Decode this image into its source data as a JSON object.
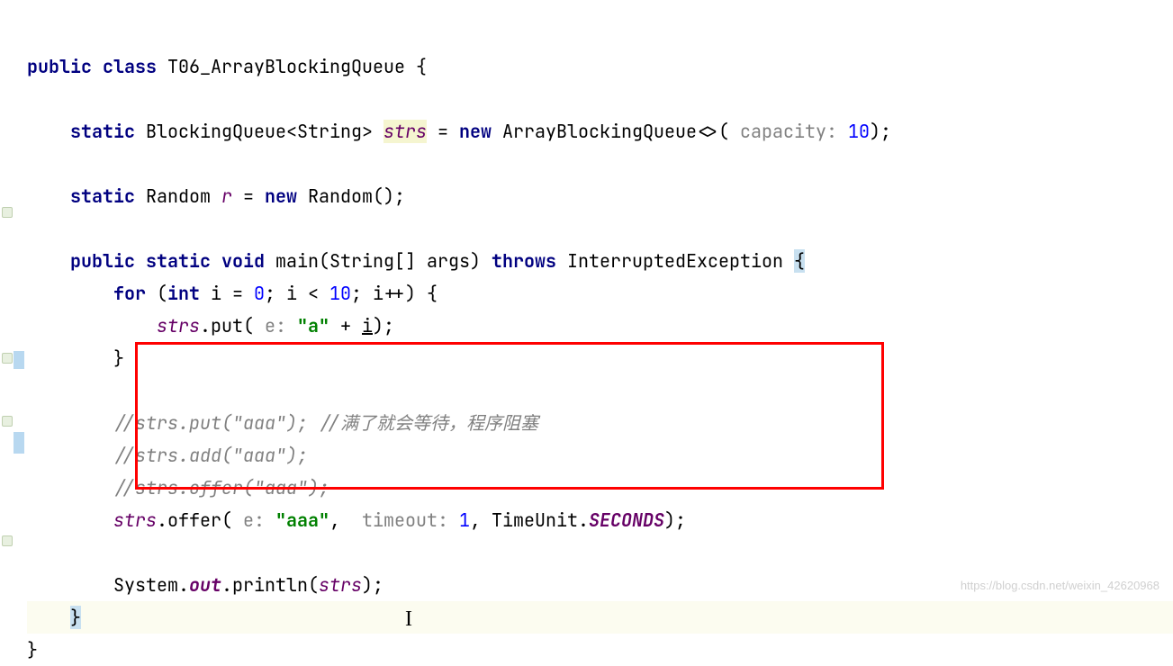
{
  "code": {
    "line1": {
      "kw_public": "public",
      "kw_class": "class",
      "class_name": "T06_ArrayBlockingQueue",
      "brace": "{"
    },
    "line3": {
      "kw_static": "static",
      "type": "BlockingQueue<String>",
      "field": "strs",
      "eq": "=",
      "kw_new": "new",
      "ctor": "ArrayBlockingQueue<>(",
      "hint_capacity": " capacity: ",
      "num": "10",
      "close": ");"
    },
    "line5": {
      "kw_static": "static",
      "type": "Random",
      "var": "r",
      "eq": "=",
      "kw_new": "new",
      "ctor": "Random();"
    },
    "line7": {
      "kw_public": "public",
      "kw_static": "static",
      "kw_void": "void",
      "method": "main(String[] args)",
      "kw_throws": "throws",
      "exception": "InterruptedException",
      "brace": "{"
    },
    "line8": {
      "kw_for": "for",
      "open": "(",
      "kw_int": "int",
      "init": "i =",
      "zero": "0",
      "cond": "; i <",
      "ten": "10",
      "inc": "; i++) {"
    },
    "line9": {
      "field": "strs",
      "call": ".put(",
      "hint_e": " e: ",
      "str": "\"a\"",
      "plus": " + ",
      "var_i": "i",
      "close": ");"
    },
    "line10": {
      "brace": "}"
    },
    "line12": {
      "comment": "//strs.put(\"aaa\"); //满了就会等待，程序阻塞"
    },
    "line13": {
      "comment": "//strs.add(\"aaa\");"
    },
    "line14": {
      "comment": "//strs.offer(\"aaa\");"
    },
    "line15": {
      "field": "strs",
      "call": ".offer(",
      "hint_e": " e: ",
      "str": "\"aaa\"",
      "comma1": ", ",
      "hint_timeout": " timeout: ",
      "num": "1",
      "comma2": ", TimeUnit.",
      "seconds": "SECONDS",
      "close": ");"
    },
    "line17": {
      "sys": "System.",
      "out": "out",
      "print": ".println(",
      "field": "strs",
      "close": ");"
    },
    "line18": {
      "brace": "}"
    },
    "line19": {
      "brace": "}"
    }
  },
  "watermark": "https://blog.csdn.net/weixin_42620968"
}
